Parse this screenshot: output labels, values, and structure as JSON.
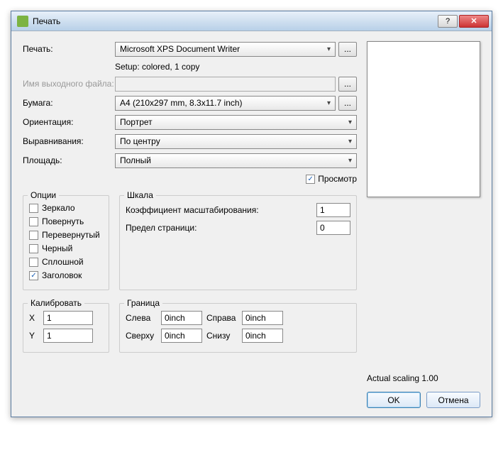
{
  "title": "Печать",
  "labels": {
    "printer": "Печать:",
    "setup": "Setup: colored, 1 copy",
    "outfile": "Имя выходного файла:",
    "paper": "Бумага:",
    "orient": "Ориентация:",
    "align": "Выравнивания:",
    "area": "Площадь:",
    "preview": "Просмотр"
  },
  "values": {
    "printer": "Microsoft XPS Document Writer",
    "outfile": "",
    "paper": "A4 (210x297 mm, 8.3x11.7 inch)",
    "orient": "Портрет",
    "align": "По центру",
    "area": "Полный"
  },
  "options": {
    "title": "Опции",
    "mirror": "Зеркало",
    "rotate": "Повернуть",
    "inverted": "Перевернутый",
    "black": "Черный",
    "solid": "Сплошной",
    "header": "Заголовок"
  },
  "scale": {
    "title": "Шкала",
    "factor_lbl": "Коэффициент масштабирования:",
    "factor": "1",
    "limit_lbl": "Предел страници:",
    "limit": "0"
  },
  "calib": {
    "title": "Калибровать",
    "x_lbl": "X",
    "x": "1",
    "y_lbl": "Y",
    "y": "1"
  },
  "border": {
    "title": "Граница",
    "left_lbl": "Слева",
    "left": "0inch",
    "right_lbl": "Справа",
    "right": "0inch",
    "top_lbl": "Сверху",
    "top": "0inch",
    "bottom_lbl": "Снизу",
    "bottom": "0inch"
  },
  "actual_scaling": "Actual scaling 1.00",
  "buttons": {
    "browse": "...",
    "ok": "OK",
    "cancel": "Отмена",
    "help": "?",
    "close": "✕"
  }
}
